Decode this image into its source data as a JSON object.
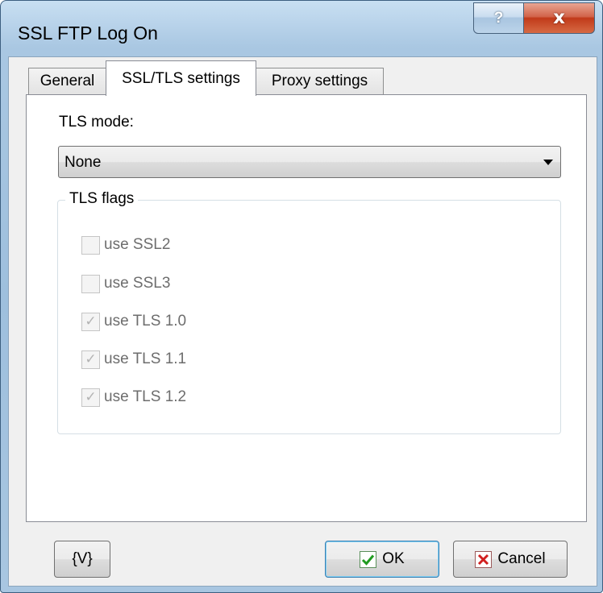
{
  "window": {
    "title": "SSL FTP Log On",
    "help_symbol": "?",
    "close_symbol": "x"
  },
  "tabs": [
    {
      "label": "General",
      "active": false
    },
    {
      "label": "SSL/TLS settings",
      "active": true
    },
    {
      "label": "Proxy settings",
      "active": false
    }
  ],
  "tls_mode": {
    "label": "TLS mode:",
    "selected": "None"
  },
  "tls_flags": {
    "legend": "TLS flags",
    "options": [
      {
        "label": "use SSL2",
        "checked": false,
        "enabled": false
      },
      {
        "label": "use SSL3",
        "checked": false,
        "enabled": false
      },
      {
        "label": "use TLS 1.0",
        "checked": true,
        "enabled": false
      },
      {
        "label": "use TLS 1.1",
        "checked": true,
        "enabled": false
      },
      {
        "label": "use TLS 1.2",
        "checked": true,
        "enabled": false
      }
    ]
  },
  "buttons": {
    "variables_label": "{V}",
    "ok_label": "OK",
    "cancel_label": "Cancel"
  },
  "colors": {
    "ok_icon": "#1f9b1f",
    "cancel_icon": "#d11f1f",
    "close_button": "#c13a1a"
  }
}
